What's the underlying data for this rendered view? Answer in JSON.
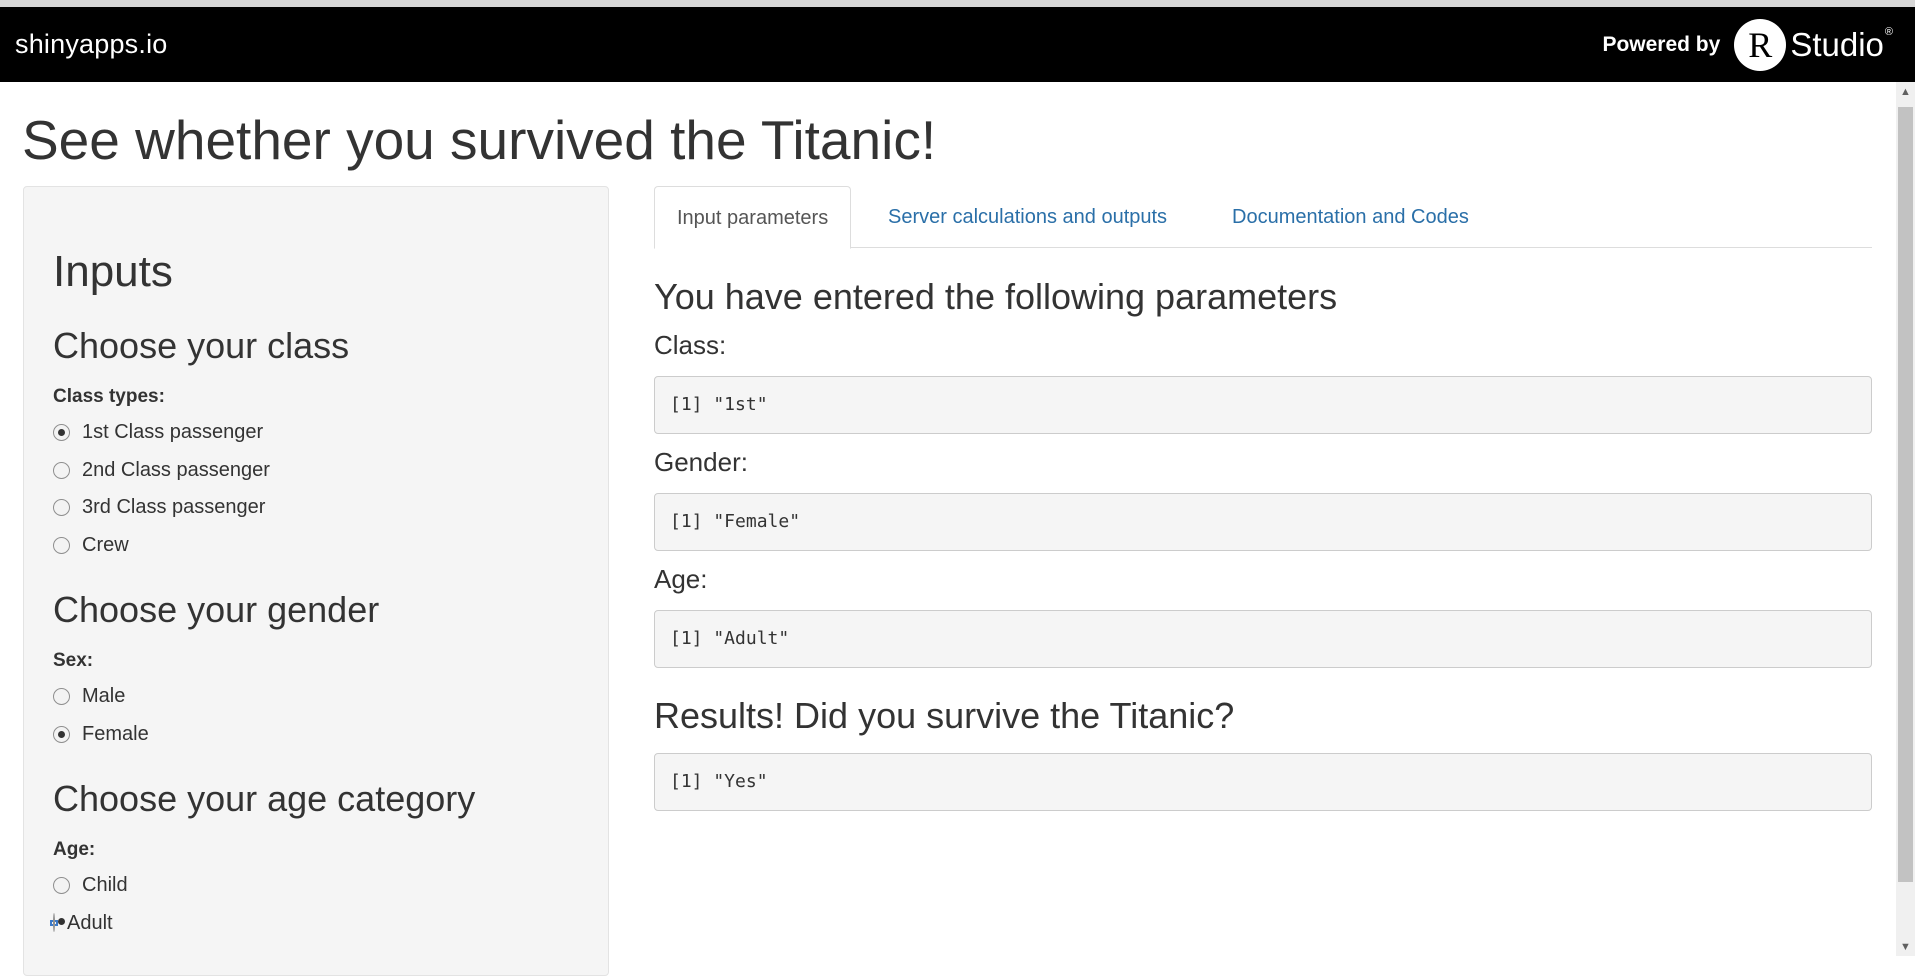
{
  "header": {
    "brand": "shinyapps.io",
    "powered_by": "Powered by",
    "logo_letter": "R",
    "logo_word": "Studio",
    "logo_mark": "®"
  },
  "page_title": "See whether you survived the Titanic!",
  "sidebar": {
    "heading": "Inputs",
    "class_section": {
      "title": "Choose your class",
      "label": "Class types:",
      "options": [
        {
          "label": "1st Class passenger",
          "checked": true
        },
        {
          "label": "2nd Class passenger",
          "checked": false
        },
        {
          "label": "3rd Class passenger",
          "checked": false
        },
        {
          "label": "Crew",
          "checked": false
        }
      ]
    },
    "gender_section": {
      "title": "Choose your gender",
      "label": "Sex:",
      "options": [
        {
          "label": "Male",
          "checked": false
        },
        {
          "label": "Female",
          "checked": true
        }
      ]
    },
    "age_section": {
      "title": "Choose your age category",
      "label": "Age:",
      "options": [
        {
          "label": "Child",
          "checked": false
        },
        {
          "label": "Adult",
          "checked": true
        }
      ]
    }
  },
  "tabs": [
    {
      "label": "Input parameters",
      "active": true
    },
    {
      "label": "Server calculations and outputs",
      "active": false
    },
    {
      "label": "Documentation and Codes",
      "active": false
    }
  ],
  "main": {
    "params_heading": "You have entered the following parameters",
    "class_label": "Class:",
    "class_value": "[1] \"1st\"",
    "gender_label": "Gender:",
    "gender_value": "[1] \"Female\"",
    "age_label": "Age:",
    "age_value": "[1] \"Adult\"",
    "results_heading": "Results! Did you survive the Titanic?",
    "result_value": "[1] \"Yes\""
  }
}
